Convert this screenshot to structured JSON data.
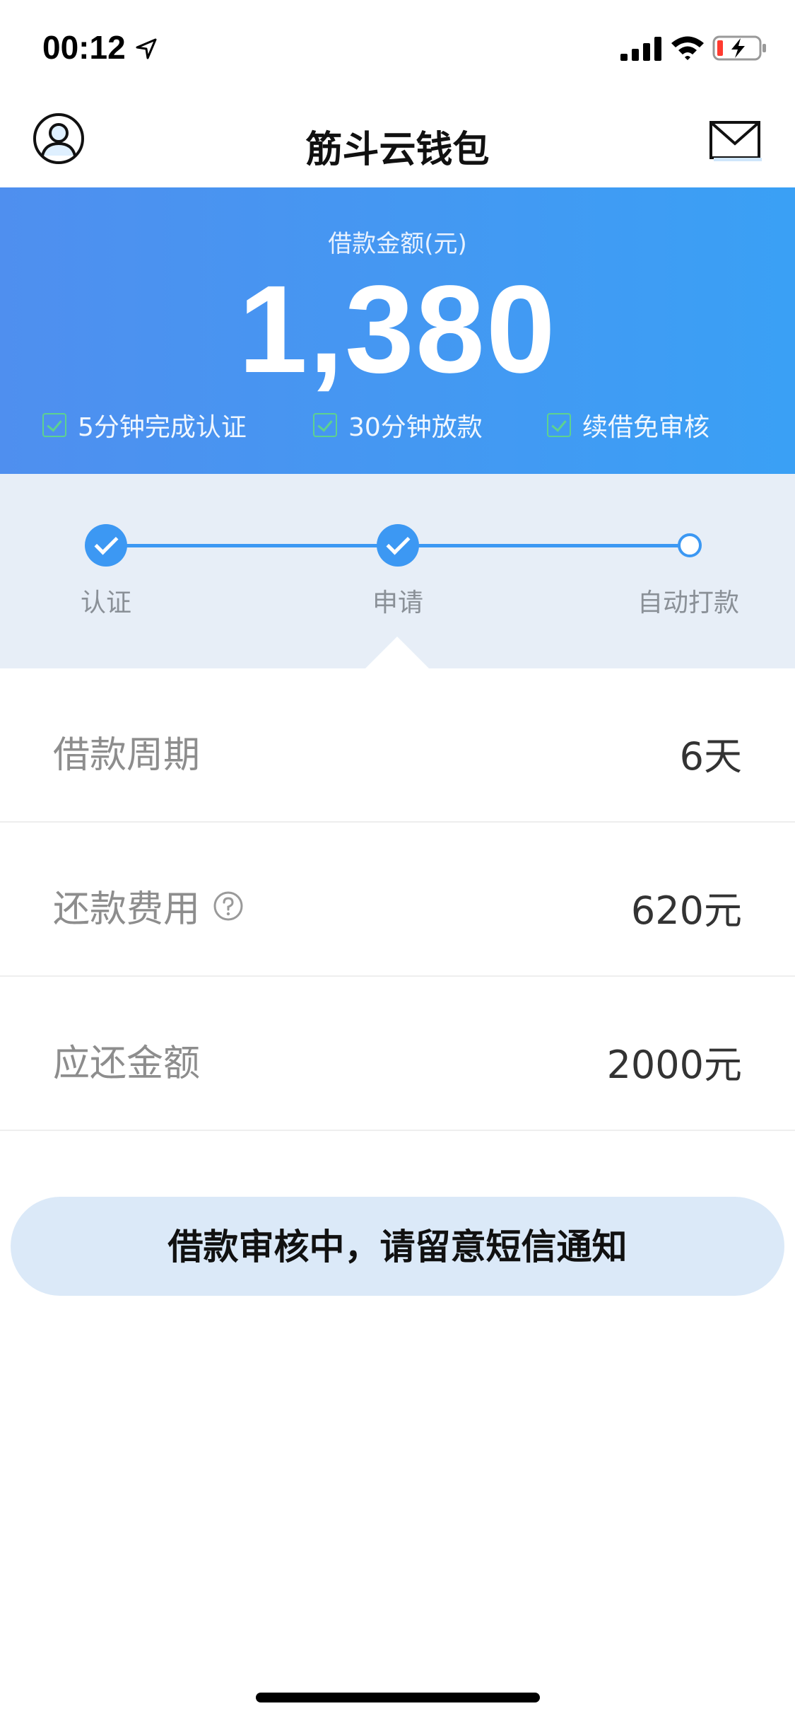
{
  "status_bar": {
    "time": "00:12"
  },
  "nav": {
    "title": "筋斗云钱包"
  },
  "hero": {
    "label": "借款金额(元)",
    "amount": "1,380",
    "features": [
      "5分钟完成认证",
      "30分钟放款",
      "续借免审核"
    ]
  },
  "steps": [
    {
      "label": "认证",
      "done": true
    },
    {
      "label": "申请",
      "done": true
    },
    {
      "label": "自动打款",
      "done": false
    }
  ],
  "rows": [
    {
      "label": "借款周期",
      "value": "6天",
      "help": false
    },
    {
      "label": "还款费用",
      "value": "620元",
      "help": true
    },
    {
      "label": "应还金额",
      "value": "2000元",
      "help": false
    }
  ],
  "status_button": {
    "label": "借款审核中，请留意短信通知"
  },
  "colors": {
    "primary": "#3c98f3",
    "check_green": "#5ed28f",
    "steps_bg": "#e7eef7",
    "button_bg": "#dbe9f8"
  }
}
